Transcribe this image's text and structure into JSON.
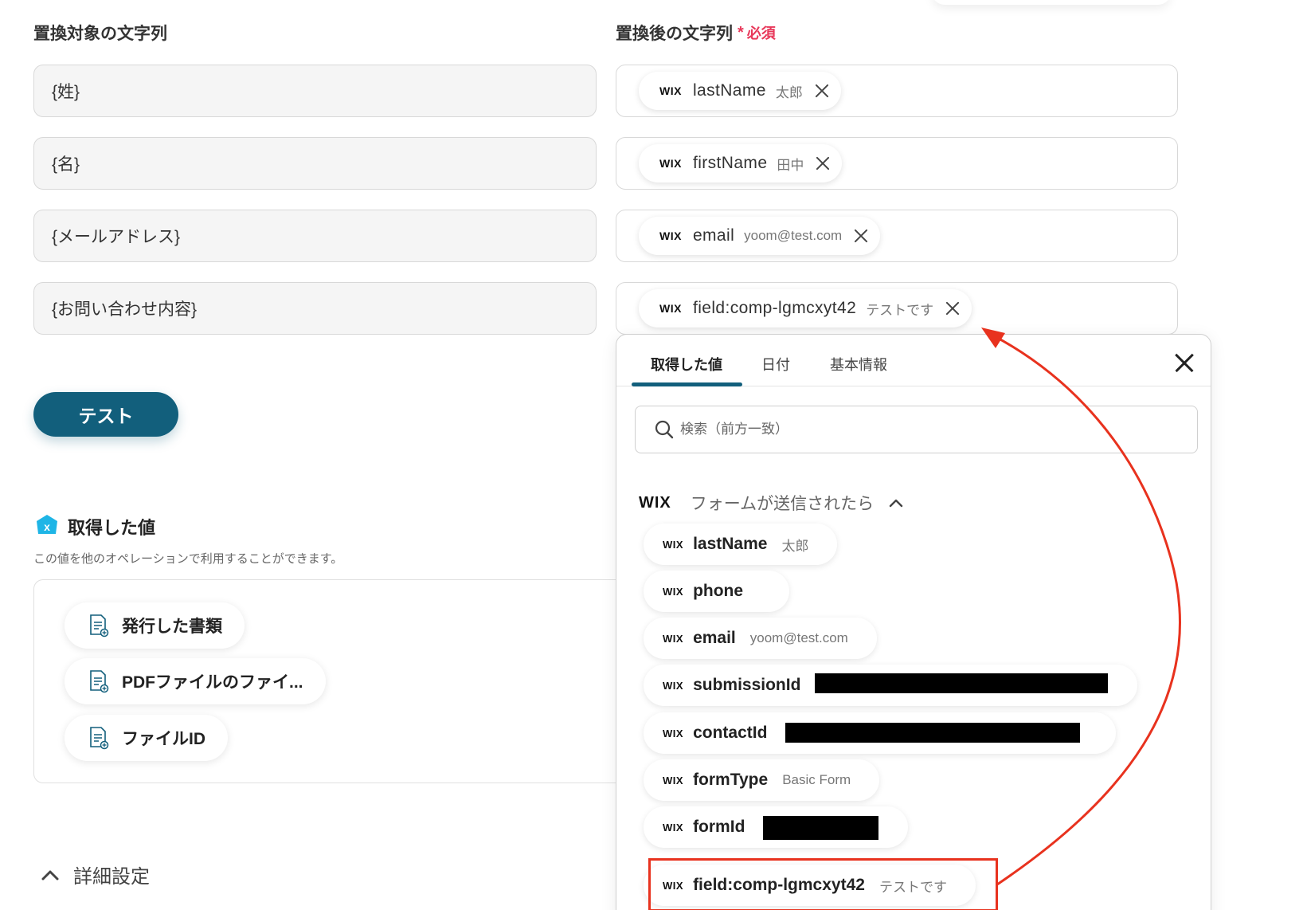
{
  "left": {
    "heading": "置換対象の文字列",
    "fields": [
      "{姓}",
      "{名}",
      "{メールアドレス}",
      "{お問い合わせ内容}"
    ]
  },
  "right": {
    "heading": "置換後の文字列",
    "required_star": "*",
    "required_label": "必須",
    "chips": [
      {
        "source": "WIX",
        "key": "lastName",
        "value": "太郎"
      },
      {
        "source": "WIX",
        "key": "firstName",
        "value": "田中"
      },
      {
        "source": "WIX",
        "key": "email",
        "value": "yoom@test.com"
      },
      {
        "source": "WIX",
        "key": "field:comp-lgmcxyt42",
        "value": "テストです"
      }
    ]
  },
  "test_button": "テスト",
  "acquired": {
    "icon_letter": "x",
    "title": "取得した値",
    "description": "この値を他のオペレーションで利用することができます。",
    "outputs": [
      "発行した書類",
      "PDFファイルのファイ...",
      "ファイルID"
    ]
  },
  "advanced": {
    "label": "詳細設定"
  },
  "panel": {
    "tabs": [
      "取得した値",
      "日付",
      "基本情報"
    ],
    "active_tab": 0,
    "search_placeholder": "検索（前方一致）",
    "group": {
      "source": "WIX",
      "title": "フォームが送信されたら"
    },
    "options": [
      {
        "source": "WIX",
        "key": "lastName",
        "value": "太郎"
      },
      {
        "source": "WIX",
        "key": "phone",
        "value": ""
      },
      {
        "source": "WIX",
        "key": "email",
        "value": "yoom@test.com"
      },
      {
        "source": "WIX",
        "key": "submissionId",
        "value": ""
      },
      {
        "source": "WIX",
        "key": "contactId",
        "value": ""
      },
      {
        "source": "WIX",
        "key": "formType",
        "value": "Basic Form"
      },
      {
        "source": "WIX",
        "key": "formId",
        "value": ""
      },
      {
        "source": "WIX",
        "key": "field:comp-lgmcxyt42",
        "value": "テストです"
      }
    ],
    "highlighted_option": 7
  },
  "colors": {
    "primary": "#125f7c",
    "required": "#e8385a",
    "annotation": "#e8321e",
    "icon_badge": "#1eb5e6"
  },
  "icons": {
    "chip_remove": "close-icon",
    "panel_close": "close-icon",
    "search": "search-icon",
    "group_toggle": "chevron-up-icon",
    "advanced_toggle": "chevron-up-icon",
    "output": "document-icon"
  }
}
